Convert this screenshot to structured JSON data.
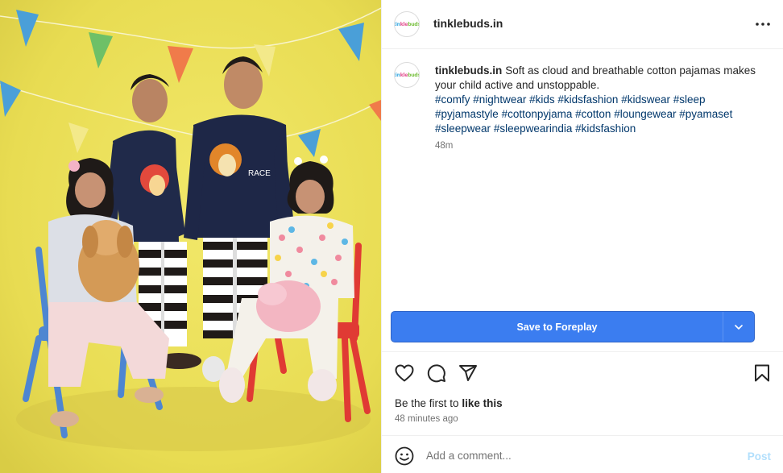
{
  "post": {
    "account": {
      "username": "tinklebuds.in",
      "avatar_logo": [
        "tin",
        "kle",
        "buds"
      ]
    },
    "image": {
      "alt": "Four children in matching pajamas posing with plush toys against a yellow backdrop with bunting"
    },
    "caption": {
      "username": "tinklebuds.in",
      "text": "Soft as cloud and breathable cotton pajamas makes your child active and unstoppable.",
      "hashtags": [
        "#comfy",
        "#nightwear",
        "#kids",
        "#kidsfashion",
        "#kidswear",
        "#sleep",
        "#pyjamastyle",
        "#cottonpyjama",
        "#cotton",
        "#loungewear",
        "#pyamaset",
        "#sleepwear",
        "#sleepwearindia",
        "#kidsfashion"
      ],
      "time_ago": "48m"
    },
    "save_button": {
      "label": "Save to Foreplay",
      "color": "#3b7df0"
    },
    "likes": {
      "prefix": "Be the first to",
      "action": "like this"
    },
    "posted_ago": "48 minutes ago",
    "comment": {
      "placeholder": "Add a comment...",
      "post_label": "Post"
    },
    "icons": {
      "more": "more-horizontal-icon",
      "like": "heart-icon",
      "comment": "comment-icon",
      "share": "share-icon",
      "save": "bookmark-icon",
      "emoji": "emoji-icon",
      "dropdown": "chevron-down-icon"
    }
  }
}
